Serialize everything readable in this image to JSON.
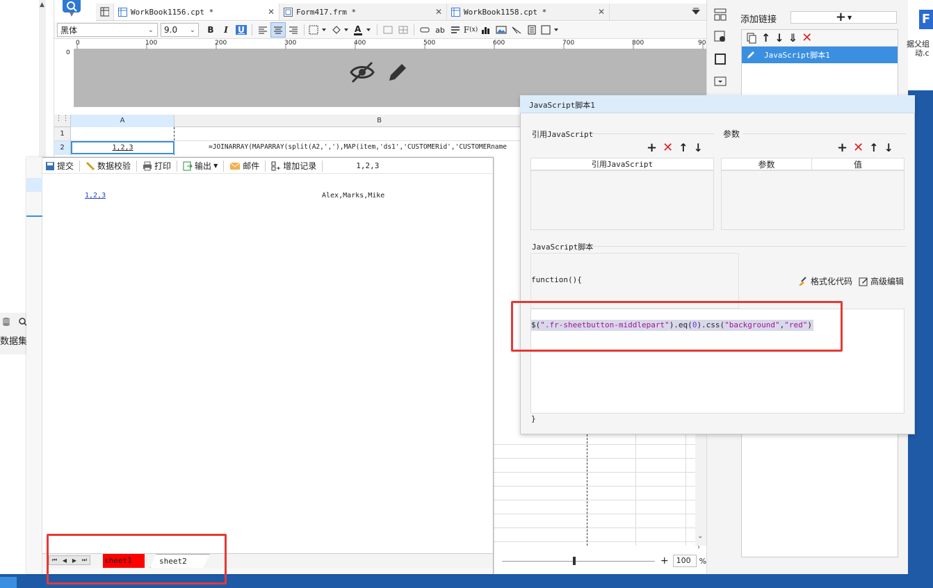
{
  "tabs": [
    {
      "label": "WorkBook1156.cpt *",
      "icon": "grid-doc-icon"
    },
    {
      "label": "Form417.frm *",
      "icon": "form-doc-icon"
    },
    {
      "label": "WorkBook1158.cpt *",
      "icon": "grid-doc-icon"
    }
  ],
  "format_toolbar": {
    "font": "黑体",
    "size": "9.0"
  },
  "ruler": {
    "ticks": [
      "0",
      "100",
      "200",
      "300",
      "400",
      "500",
      "600",
      "700",
      "800",
      "90"
    ],
    "vertical_tick": "0"
  },
  "grid": {
    "col_a": "A",
    "col_b": "B",
    "rows": [
      "1",
      "2"
    ],
    "a2": "1,2,3",
    "b2": "=JOINARRAY(MAPARRAY(split(A2,','),MAP(item,'ds1','CUSTOMERid','CUSTOMERname"
  },
  "link_panel": {
    "add_label": "添加链接",
    "item": "JavaScript脚本1"
  },
  "left_dock": {
    "label": "数据集"
  },
  "preview": {
    "toolbar": [
      {
        "label": "提交",
        "icon": "save-icon"
      },
      {
        "label": "数据校验",
        "icon": "validate-icon"
      },
      {
        "label": "打印",
        "icon": "print-icon"
      },
      {
        "label": "输出",
        "icon": "export-icon"
      },
      {
        "label": "邮件",
        "icon": "mail-icon"
      },
      {
        "label": "增加记录",
        "icon": "add-record-icon"
      }
    ],
    "toolbar_value": "1,2,3",
    "cell_link": "1,2,3",
    "cell_value": "Alex,Marks,Mike",
    "sheets": [
      "sheet1",
      "sheet2"
    ],
    "sheet1_bg": "#ff0000"
  },
  "zoom": {
    "minus": "-",
    "plus": "+",
    "value": "100",
    "unit": "%"
  },
  "js_dialog": {
    "title": "JavaScript脚本1",
    "ref_section": "引用JavaScript",
    "param_section": "参数",
    "ref_col": "引用JavaScript",
    "param_col": "参数",
    "value_col": "值",
    "script_section": "JavaScript脚本",
    "fn_open": "function(){",
    "format_code": "格式化代码",
    "advanced_edit": "高级编辑",
    "code": {
      "p1": "$(",
      "p2": "\".fr-sheetbutton-middlepart\"",
      "p3": ").eq(",
      "p4": "0",
      "p5": ").css(",
      "p6": "\"background\"",
      "p7": ",",
      "p8": "\"red\"",
      "p9": ")"
    },
    "fn_close": "}"
  },
  "right_edge": {
    "text1": "据父组",
    "text2": "动.c"
  },
  "colors": {
    "accent": "#3a8ee6",
    "highlight_red": "#e53935",
    "selected_blue": "#3b8fe0",
    "code_string": "#a31596"
  }
}
